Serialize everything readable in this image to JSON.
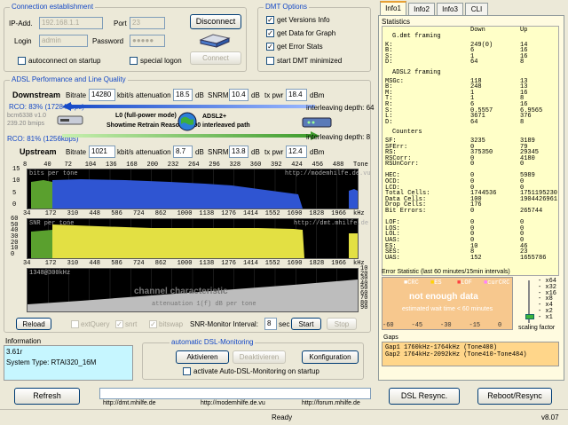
{
  "conn": {
    "title": "Connection establishment",
    "ip_label": "IP-Add.",
    "ip_value": "192.168.1.1",
    "port_label": "Port",
    "port_value": "23",
    "login_label": "Login",
    "login_value": "admin",
    "password_label": "Password",
    "password_value": "●●●●●",
    "disconnect": "Disconnect",
    "connect": "Connect",
    "autoconnect": "autoconnect on startup",
    "special_logon": "special logon"
  },
  "dmt": {
    "title": "DMT Options",
    "opt1": "get Versions Info",
    "opt2": "get Data for Graph",
    "opt3": "get Error Stats",
    "opt4": "start DMT minimized"
  },
  "adsl": {
    "title": "ADSL Performance and Line Quality",
    "downstream": "Downstream",
    "upstream": "Upstream",
    "bitrate_label": "Bitrate",
    "att_label": "attenuation",
    "snr_label": "SNRM",
    "tx_label": "tx pwr",
    "ds_bitrate": "14280",
    "ds_att": "18.5",
    "ds_snr": "10.4",
    "ds_tx": "18.4",
    "us_bitrate": "1021",
    "us_att": "8.7",
    "us_snr": "13.8",
    "us_tx": "12.4",
    "kbits": "kbit/s",
    "db": "dB",
    "dbm": "dBm",
    "rco_ds": "RCO: 83% (17284kbps)",
    "rco_us": "RCO: 81% (1256kbps)",
    "chip": "bcm6338 v1.0",
    "fw": "239.20 bmips",
    "link_lines": [
      "L0 (full-power mode)",
      "Showtime Retrain Reason: 8000"
    ],
    "adsl_mode": [
      "ADSL2+",
      "interleaved path"
    ],
    "ileave_ds": "interleaving depth: 64",
    "ileave_us": "interleaving depth: 8",
    "ticks_top": [
      "8",
      "40",
      "72",
      "104",
      "136",
      "168",
      "200",
      "232",
      "264",
      "296",
      "328",
      "360",
      "392",
      "424",
      "456",
      "488",
      "Tone"
    ],
    "ticks_bits": [
      "34",
      "172",
      "310",
      "448",
      "586",
      "724",
      "862",
      "1000",
      "1138",
      "1276",
      "1414",
      "1552",
      "1690",
      "1828",
      "1966",
      "kHz"
    ],
    "bits_title": "bits per tone",
    "bits_url": "http://modemhilfe.de.vu",
    "snr_title": "SNR per tone",
    "snr_url": "http://dmt.mhilfe.de",
    "ticks_snr": [
      "34",
      "172",
      "310",
      "448",
      "586",
      "724",
      "862",
      "1000",
      "1138",
      "1276",
      "1414",
      "1552",
      "1690",
      "1828",
      "1966",
      "kHz"
    ],
    "ch_title": "channel characteristic",
    "ch_sub": "attenuation 1(f) dB per tone",
    "ch_sub2": "1348@300kHz",
    "ch_yticks": [
      "10",
      "20",
      "30",
      "40",
      "50",
      "60",
      "70",
      "80",
      "90"
    ],
    "bits_yticks": [
      "15",
      "10",
      "5",
      "0"
    ],
    "snr_yticks": [
      "60",
      "50",
      "40",
      "30",
      "20",
      "10",
      "0"
    ],
    "reload": "Reload",
    "extquery": "extQuery",
    "snrt": "snrt",
    "bitswap": "bitswap",
    "snr_interval_label": "SNR-Monitor Interval:",
    "snr_interval": "8",
    "sec": "sec",
    "start": "Start",
    "stop": "Stop"
  },
  "info": {
    "title": "Information",
    "lines": [
      "3.61r",
      "System Type:  RTAI320_16M"
    ]
  },
  "auto": {
    "title": "automatic DSL-Monitoring",
    "activate": "Aktivieren",
    "deactivate": "Deaktivieren",
    "config": "Konfiguration",
    "startup": "activate Auto-DSL-Monitoring on startup"
  },
  "tabs": [
    "Info1",
    "Info2",
    "Info3",
    "CLI"
  ],
  "stats": {
    "title": "Statistics",
    "col_down": "Down",
    "col_up": "Up",
    "gdmt": "G.dmt framing",
    "gdmt_rows": [
      [
        "K:",
        "249(0)",
        "14"
      ],
      [
        "B:",
        "6",
        "16"
      ],
      [
        "S:",
        "1",
        "16"
      ],
      [
        "D:",
        "64",
        "8"
      ]
    ],
    "adsl2": "ADSL2 framing",
    "adsl2_rows": [
      [
        "MSGc:",
        "118",
        "13"
      ],
      [
        "B:",
        "248",
        "13"
      ],
      [
        "M:",
        "1",
        "16"
      ],
      [
        "T:",
        "1",
        "8"
      ],
      [
        "R:",
        "6",
        "16"
      ],
      [
        "S:",
        "0.5557",
        "6.9565"
      ],
      [
        "L:",
        "3671",
        "376"
      ],
      [
        "D:",
        "64",
        "8"
      ]
    ],
    "counters": "Counters",
    "cnt_rows": [
      [
        "SF:",
        "3235",
        "3189"
      ],
      [
        "SFErr:",
        "0",
        "79"
      ],
      [
        "RS:",
        "375350",
        "29345"
      ],
      [
        "RSCorr:",
        "0",
        "4180"
      ],
      [
        "RSUnCorr:",
        "0",
        "0"
      ],
      [
        "",
        "",
        ""
      ],
      [
        "HEC:",
        "0",
        "5989"
      ],
      [
        "OCD:",
        "0",
        "0"
      ],
      [
        "LCD:",
        "0",
        "0"
      ],
      [
        "Total Cells:",
        "1744536",
        "1751195230"
      ],
      [
        "Data Cells:",
        "100",
        "1904426961"
      ],
      [
        "Drop Cells:",
        "176",
        ""
      ],
      [
        "Bit Errors:",
        "0",
        "265744"
      ],
      [
        "",
        "",
        ""
      ],
      [
        "LOF:",
        "0",
        "0"
      ],
      [
        "LOS:",
        "0",
        "0"
      ],
      [
        "LOL:",
        "0",
        "0"
      ],
      [
        "UAS:",
        "0",
        "0"
      ],
      [
        "ES:",
        "10",
        "46"
      ],
      [
        "SES:",
        "8",
        "23"
      ],
      [
        "UAS:",
        "152",
        "1655786"
      ]
    ]
  },
  "errstat": {
    "title": "Error Statistic (last 60 minutes/15min intervals)",
    "legend": [
      "CRC",
      "ES",
      "LOF",
      "curCRC"
    ],
    "legend_colors": [
      "#ffffff",
      "#ffd400",
      "#ff4040",
      "#ff80ff"
    ],
    "msg": "not enough data",
    "sub": "estimated wait time < 60 minutes",
    "xticks": [
      "-60",
      "-45",
      "-30",
      "-15",
      "0"
    ],
    "scale": [
      "x64",
      "x32",
      "x16",
      "x8",
      "x4",
      "x2",
      "x1"
    ],
    "scale_label": "scaling factor"
  },
  "gaps": {
    "title": "Gaps",
    "lines": [
      "Gap1 1760kHz-1764kHz (Tone408)",
      "Gap2 1764kHz-2092kHz (Tone410-Tone484)"
    ]
  },
  "footer": {
    "refresh": "Refresh",
    "dsl_resync": "DSL Resync.",
    "reboot": "Reboot/Resync",
    "link1": "http://dmt.mhilfe.de",
    "link2": "http://modemhilfe.de.vu",
    "link3": "http://forum.mhilfe.de",
    "status": "Ready",
    "version": "v8.07"
  },
  "colors": {
    "bits": "#2f55d2",
    "snr": "#e3e043",
    "upstream": "#5aa02e",
    "gap": "#ffd000",
    "ch": "#bdbdbd",
    "legend_blue": "#1448c6",
    "tab_bg": "#ffffc8"
  }
}
